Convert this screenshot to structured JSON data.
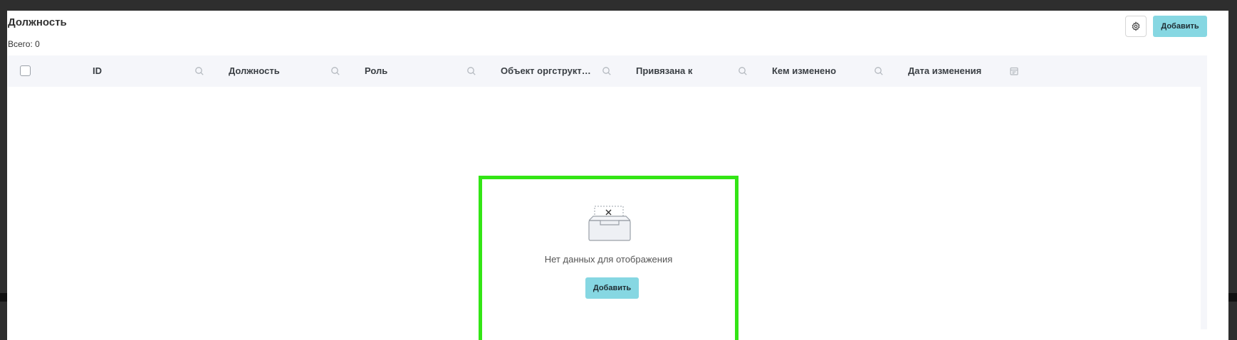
{
  "header": {
    "title": "Должность",
    "total_label": "Всего: 0",
    "add_label": "Добавить"
  },
  "table": {
    "columns": [
      {
        "label": "ID",
        "icon": "search-icon"
      },
      {
        "label": "Должность",
        "icon": "search-icon"
      },
      {
        "label": "Роль",
        "icon": "search-icon"
      },
      {
        "label": "Объект оргструкт…",
        "icon": "search-icon"
      },
      {
        "label": "Привязана к",
        "icon": "search-icon"
      },
      {
        "label": "Кем изменено",
        "icon": "search-icon"
      },
      {
        "label": "Дата изменения",
        "icon": "calendar-icon"
      }
    ],
    "rows": []
  },
  "empty_state": {
    "message": "Нет данных для отображения",
    "add_label": "Добавить",
    "icon": "empty-inbox-icon"
  },
  "colors": {
    "accent": "#86d7e2",
    "highlight": "#33e515",
    "header_bg": "#f5f6fa"
  }
}
